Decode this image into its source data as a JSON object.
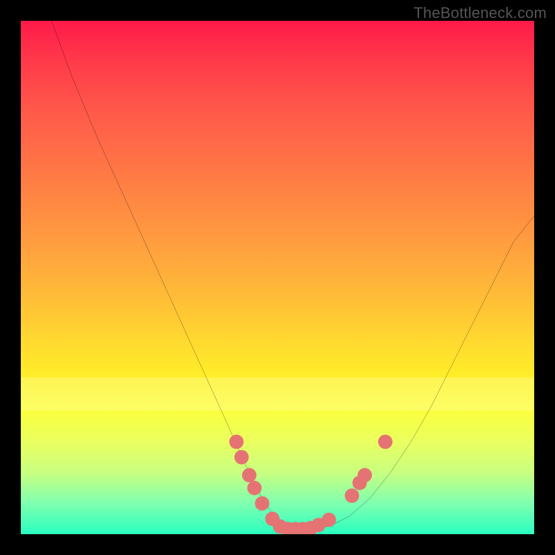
{
  "watermark": "TheBottleneck.com",
  "chart_data": {
    "type": "line",
    "title": "",
    "xlabel": "",
    "ylabel": "",
    "xlim": [
      0,
      100
    ],
    "ylim": [
      0,
      100
    ],
    "grid": false,
    "series": [
      {
        "name": "curve",
        "x": [
          6,
          10,
          15,
          20,
          25,
          30,
          35,
          40,
          44,
          47,
          50,
          53,
          56,
          60,
          64,
          68,
          72,
          76,
          80,
          84,
          88,
          92,
          96,
          100
        ],
        "values": [
          100,
          89,
          77,
          66,
          55,
          44,
          33,
          22,
          13,
          7,
          2.5,
          1,
          1,
          1.5,
          3.5,
          7,
          12,
          18,
          25,
          33,
          41,
          49,
          57,
          62
        ]
      }
    ],
    "markers": [
      {
        "x": 42.0,
        "y": 18.0
      },
      {
        "x": 43.0,
        "y": 15.0
      },
      {
        "x": 44.5,
        "y": 11.5
      },
      {
        "x": 45.5,
        "y": 9.0
      },
      {
        "x": 47.0,
        "y": 6.0
      },
      {
        "x": 49.0,
        "y": 3.0
      },
      {
        "x": 50.5,
        "y": 1.5
      },
      {
        "x": 52.0,
        "y": 1.0
      },
      {
        "x": 53.5,
        "y": 1.0
      },
      {
        "x": 55.0,
        "y": 1.0
      },
      {
        "x": 56.5,
        "y": 1.2
      },
      {
        "x": 58.0,
        "y": 1.8
      },
      {
        "x": 60.0,
        "y": 2.8
      },
      {
        "x": 64.5,
        "y": 7.5
      },
      {
        "x": 66.0,
        "y": 10.0
      },
      {
        "x": 67.0,
        "y": 11.5
      },
      {
        "x": 71.0,
        "y": 18.0
      }
    ],
    "marker_color": "#e57373",
    "marker_radius": 1.4,
    "gradient_stops": [
      {
        "pos": 0,
        "color": "#ff1a4a"
      },
      {
        "pos": 18,
        "color": "#ff5a4a"
      },
      {
        "pos": 42,
        "color": "#ff9a40"
      },
      {
        "pos": 62,
        "color": "#ffd830"
      },
      {
        "pos": 76,
        "color": "#fbff3e"
      },
      {
        "pos": 88,
        "color": "#c8ff80"
      },
      {
        "pos": 100,
        "color": "#2affc0"
      }
    ]
  }
}
